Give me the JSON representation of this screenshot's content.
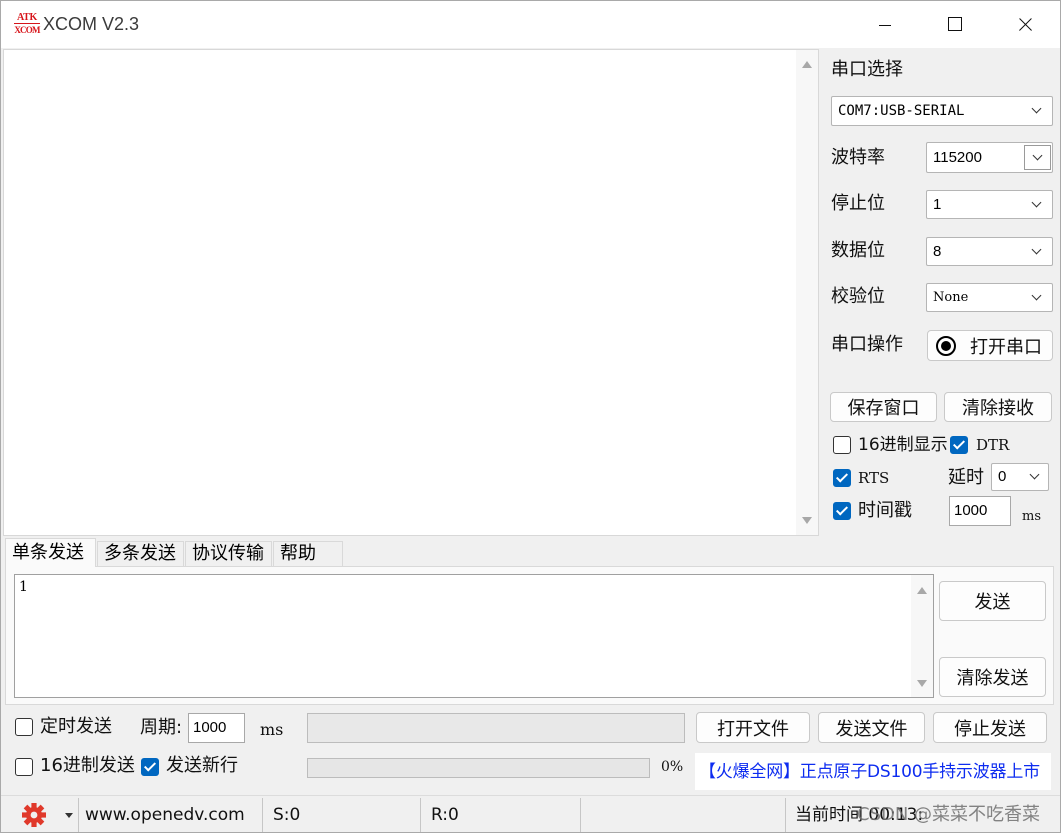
{
  "window": {
    "title": "XCOM V2.3",
    "logo_top": "ATK",
    "logo_bottom": "XCOM"
  },
  "receive": {
    "text": ""
  },
  "serial": {
    "port_label": "串口选择",
    "port_value": "COM7:USB-SERIAL",
    "baud_label": "波特率",
    "baud_value": "115200",
    "stop_label": "停止位",
    "stop_value": "1",
    "data_label": "数据位",
    "data_value": "8",
    "parity_label": "校验位",
    "parity_value": "None",
    "op_label": "串口操作",
    "open_button": "打开串口"
  },
  "receive_controls": {
    "save_button": "保存窗口",
    "clear_button": "清除接收",
    "hex_display": {
      "label": "16进制显示",
      "checked": false
    },
    "dtr": {
      "label": "DTR",
      "checked": true
    },
    "rts": {
      "label": "RTS",
      "checked": true
    },
    "delay_label": "延时",
    "delay_value": "0",
    "timestamp": {
      "label": "时间戳",
      "checked": true
    },
    "timestamp_value": "1000",
    "timestamp_unit": "ms"
  },
  "tabs": [
    {
      "label": "单条发送",
      "selected": true
    },
    {
      "label": "多条发送",
      "selected": false
    },
    {
      "label": "协议传输",
      "selected": false
    },
    {
      "label": "帮助",
      "selected": false
    }
  ],
  "send": {
    "text": "1",
    "send_button": "发送",
    "clear_button": "清除发送"
  },
  "send_options": {
    "timed_send": {
      "label": "定时发送",
      "checked": false
    },
    "period_label": "周期:",
    "period_value": "1000",
    "period_unit": "ms",
    "file_path": "",
    "open_file_button": "打开文件",
    "send_file_button": "发送文件",
    "stop_send_button": "停止发送",
    "hex_send": {
      "label": "16进制发送",
      "checked": false
    },
    "new_line": {
      "label": "发送新行",
      "checked": true
    },
    "progress": 0,
    "progress_text": "0%",
    "ad_link": "【火爆全网】正点原子DS100手持示波器上市"
  },
  "status": {
    "website": "www.openedv.com",
    "sent": "S:0",
    "received": "R:0",
    "time": "当前时间 00:13:",
    "watermark": "CSDN @菜菜不吃香菜"
  },
  "icons": {
    "app_logo": "atk-logo-icon",
    "minimize": "minimize-icon",
    "maximize": "maximize-icon",
    "close": "close-icon",
    "port_state": "port-state-indicator-icon",
    "settings": "gear-icon",
    "settings_menu": "caret-down-icon",
    "dropdown": "chevron-down-icon"
  },
  "colors": {
    "accent": "#0067c0",
    "link": "#0d2cf0",
    "logo": "#d7141a",
    "gear": "#e0392b",
    "background": "#f0f0f0"
  }
}
